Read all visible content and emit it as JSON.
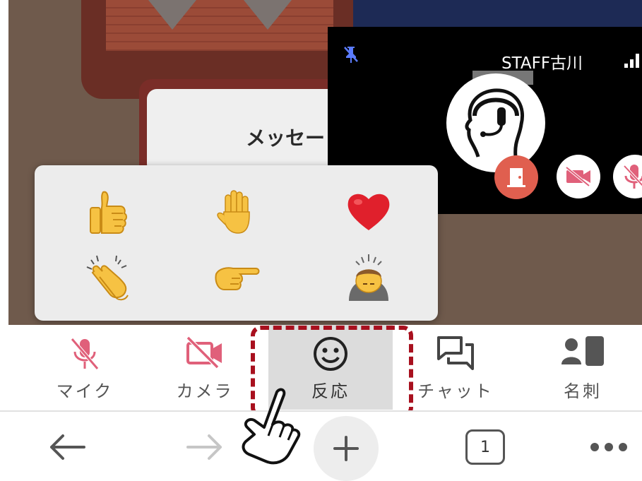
{
  "background_card": {
    "title": "メッセー"
  },
  "video_tile": {
    "participant_name": "STAFF古川"
  },
  "reactions": [
    {
      "emoji": "👍",
      "name": "thumbs-up"
    },
    {
      "emoji": "✋",
      "name": "raised-hand"
    },
    {
      "emoji": "❤️",
      "name": "heart"
    },
    {
      "emoji": "👏",
      "name": "clapping-hands"
    },
    {
      "emoji": "👉",
      "name": "pointing-right"
    },
    {
      "emoji": "🙇",
      "name": "bowing-person"
    }
  ],
  "toolbar": {
    "mic_label": "マイク",
    "camera_label": "カメラ",
    "reaction_label": "反応",
    "chat_label": "チャット",
    "card_label": "名刺"
  },
  "navbar": {
    "tab_count": "1"
  },
  "colors": {
    "highlight": "#a8101e",
    "muted_red": "#e0607a",
    "leave_red": "#e05f4f"
  }
}
